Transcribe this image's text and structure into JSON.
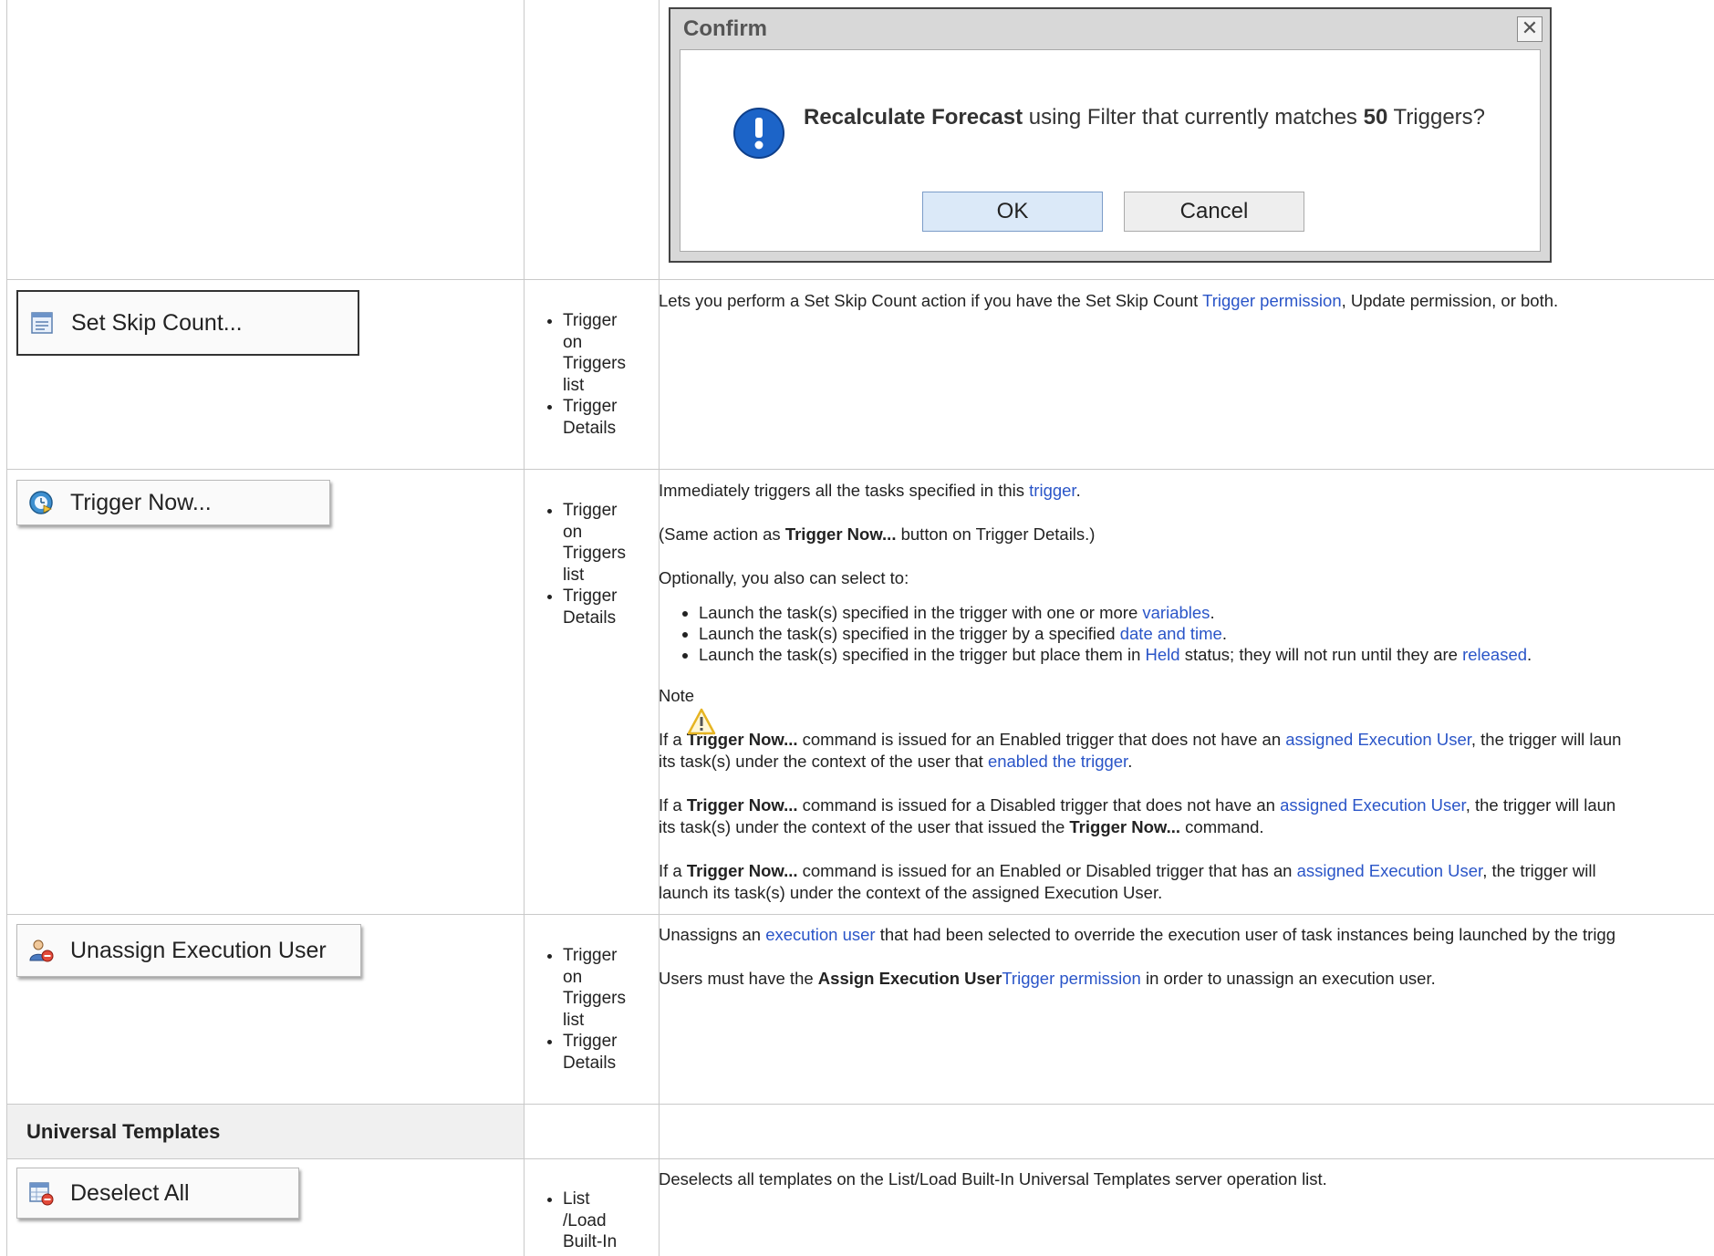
{
  "dialog": {
    "title": "Confirm",
    "close_glyph": "✕",
    "msg_bold": "Recalculate Forecast",
    "msg_mid": " using Filter that currently matches ",
    "msg_count": "50",
    "msg_end": " Triggers?",
    "ok": "OK",
    "cancel": "Cancel"
  },
  "rows": {
    "skip": {
      "button": "Set Skip Count...",
      "locations": [
        "Trigger on Triggers list",
        "Trigger Details"
      ],
      "d1": "Lets you perform a Set Skip Count action if you have the Set Skip Count ",
      "d1_link": "Trigger permission",
      "d1_end": ", Update permission, or both."
    },
    "now": {
      "button": "Trigger Now...",
      "locations": [
        "Trigger on Triggers list",
        "Trigger Details"
      ],
      "p1": "Immediately triggers all the tasks specified in this ",
      "p1_link": "trigger",
      "p1_end": ".",
      "p2a": "(Same action as ",
      "p2b": "Trigger Now...",
      "p2c": " button on Trigger Details.)",
      "p3": "Optionally, you also can select to:",
      "b1": "Launch the task(s) specified in the trigger with one or more ",
      "b1_link": "variables",
      "b1_end": ".",
      "b2": "Launch the task(s) specified in the trigger by a specified ",
      "b2_link": "date and time",
      "b2_end": ".",
      "b3": "Launch the task(s) specified in the trigger but place them in ",
      "b3_link": "Held",
      "b3_mid": " status; they will not run until they are ",
      "b3_link2": "released",
      "b3_end": ".",
      "note_title": "Note",
      "n1a": "If a ",
      "n1b": "Trigger Now...",
      "n1c": " command is issued for an Enabled trigger that does not have an ",
      "n1_link": "assigned Execution User",
      "n1d": ", the trigger will laun",
      "n1e": "its task(s) under the context of the user that ",
      "n1_link2": "enabled the trigger",
      "n1f": ".",
      "n2a": "If a ",
      "n2b": "Trigger Now...",
      "n2c": " command is issued for a Disabled trigger that does not have an ",
      "n2_link": "assigned Execution User",
      "n2d": ", the trigger will laun",
      "n2e": "its task(s) under the context of the user that issued the ",
      "n2f": "Trigger Now...",
      "n2g": " command.",
      "n3a": "If a ",
      "n3b": "Trigger Now...",
      "n3c": " command is issued for an Enabled or Disabled trigger that has an ",
      "n3_link": "assigned Execution User",
      "n3d": ", the trigger will",
      "n3e": "launch its task(s) under the context of the assigned Execution User."
    },
    "unassign": {
      "button": "Unassign Execution User",
      "locations": [
        "Trigger on Triggers list",
        "Trigger Details"
      ],
      "p1": "Unassigns an ",
      "p1_link": "execution user",
      "p1_end": " that had been selected to override the execution user of task instances being launched by the trigg",
      "p2a": "Users must have the ",
      "p2b": "Assign Execution User",
      "p2_link": "Trigger permission",
      "p2c": " in order to unassign an execution user."
    },
    "section": {
      "title": "Universal Templates"
    },
    "deselect": {
      "button": "Deselect All",
      "locations": [
        "List /Load Built-In"
      ],
      "p1": "Deselects all templates on the List/Load Built-In Universal Templates server operation list."
    }
  },
  "icons": {
    "info": "info-exclamation-icon",
    "skip": "skip-count-icon",
    "now": "trigger-now-icon",
    "unassign": "unassign-user-icon",
    "deselect": "deselect-all-icon",
    "warning": "warning-icon"
  },
  "colors": {
    "link": "#2a55c8",
    "dialog_button": "#dbe9f8",
    "info_blue": "#1c64c8"
  }
}
